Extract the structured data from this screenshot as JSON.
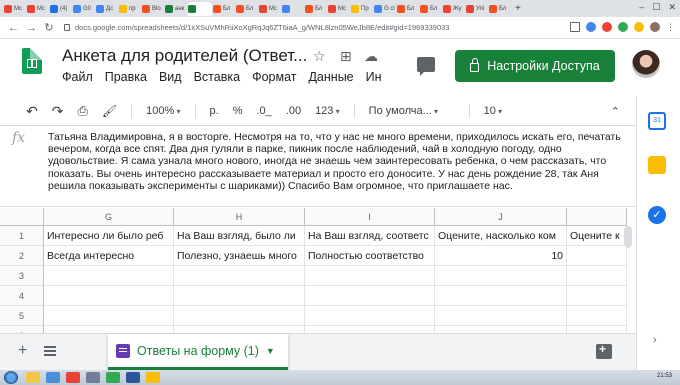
{
  "browser": {
    "tabs": [
      {
        "label": "Mc",
        "color": "#ea4335"
      },
      {
        "label": "Mc",
        "color": "#ea4335"
      },
      {
        "label": "(4)",
        "color": "#1a73e8"
      },
      {
        "label": "G0",
        "color": "#4285f4"
      },
      {
        "label": "Дс",
        "color": "#4285f4"
      },
      {
        "label": "пр",
        "color": "#fbbc04"
      },
      {
        "label": "Blo",
        "color": "#f4511e"
      },
      {
        "label": "анк",
        "color": "#188038"
      },
      {
        "label": "",
        "color": "#188038",
        "active": true
      },
      {
        "label": "Бл",
        "color": "#f4511e"
      },
      {
        "label": "Бл",
        "color": "#f4511e"
      },
      {
        "label": "Mc",
        "color": "#ea4335"
      },
      {
        "label": "",
        "color": "#4285f4"
      },
      {
        "label": "Бл",
        "color": "#f4511e"
      },
      {
        "label": "Mc",
        "color": "#ea4335"
      },
      {
        "label": "Пр",
        "color": "#fbbc04"
      },
      {
        "label": "G ci",
        "color": "#4285f4"
      },
      {
        "label": "Бл",
        "color": "#f4511e"
      },
      {
        "label": "Бл",
        "color": "#f4511e"
      },
      {
        "label": "Жу",
        "color": "#ea4335"
      },
      {
        "label": "Упі",
        "color": "#ea4335"
      },
      {
        "label": "Бл",
        "color": "#f4511e"
      }
    ],
    "url": "docs.google.com/spreadsheets/d/1xXSuVMhRiiXoXgRqJq6ZT6iaA_g/WNL8lzn05WeJb8E/edit#gid=1969339033",
    "back_icon": "back-arrow-icon",
    "forward_icon": "forward-arrow-icon",
    "reload_icon": "reload-icon"
  },
  "header": {
    "title": "Анкета для родителей (Ответ...",
    "menu": [
      "Файл",
      "Правка",
      "Вид",
      "Вставка",
      "Формат",
      "Данные",
      "Ин"
    ],
    "share_label": "Настройки Доступа",
    "share_color": "#188038"
  },
  "toolbar": {
    "zoom": "100%",
    "currency": "р.",
    "percent": "%",
    "dec_less": ".0_",
    "dec_more": ".00",
    "format_more": "123",
    "font": "По умолча...",
    "font_size": "10"
  },
  "formula_bar": {
    "fx_label": "fx",
    "content": "Татьяна Владимировна, я в восторге. Несмотря на  то, что у нас не много времени, приходилось искать его, печатать вечером, когда все спят. Два дня гуляли в парке, пикник после наблюдений, чай в холодную погоду, одно удовольствие.  Я сама узнала много нового, иногда не знаешь чем заинтересовать ребенка, о чем рассказать, что показать. Вы очень интересно рассказываете материал и просто его доносите. У нас день рождение 28, так Аня решила показывать эксперименты с шариками))  Спасибо Вам огромное, что приглашаете нас."
  },
  "grid": {
    "columns": [
      "G",
      "H",
      "I",
      "J",
      ""
    ],
    "rows": [
      {
        "num": "1",
        "cells": [
          "Интересно ли было реб",
          "На Ваш взгляд, было ли",
          "На Ваш взгляд, соответс",
          "Оцените, насколько ком",
          "Оцените к"
        ]
      },
      {
        "num": "2",
        "cells": [
          "Всегда интересно",
          "Полезно, узнаешь много",
          "Полностью соответство",
          "10",
          ""
        ]
      },
      {
        "num": "3",
        "cells": [
          "",
          "",
          "",
          "",
          ""
        ]
      },
      {
        "num": "4",
        "cells": [
          "",
          "",
          "",
          "",
          ""
        ]
      },
      {
        "num": "5",
        "cells": [
          "",
          "",
          "",
          "",
          ""
        ]
      },
      {
        "num": "6",
        "cells": [
          "",
          "",
          "",
          "",
          ""
        ]
      }
    ]
  },
  "sheet_tabs": {
    "add_label": "+",
    "active_tab": "Ответы на форму (1)",
    "active_color": "#188038"
  },
  "side_panel": [
    {
      "name": "calendar-icon",
      "color": "#1a73e8"
    },
    {
      "name": "keep-icon",
      "color": "#fbbc04"
    },
    {
      "name": "tasks-icon",
      "color": "#1a73e8"
    }
  ],
  "taskbar": {
    "clock": "21:53"
  }
}
